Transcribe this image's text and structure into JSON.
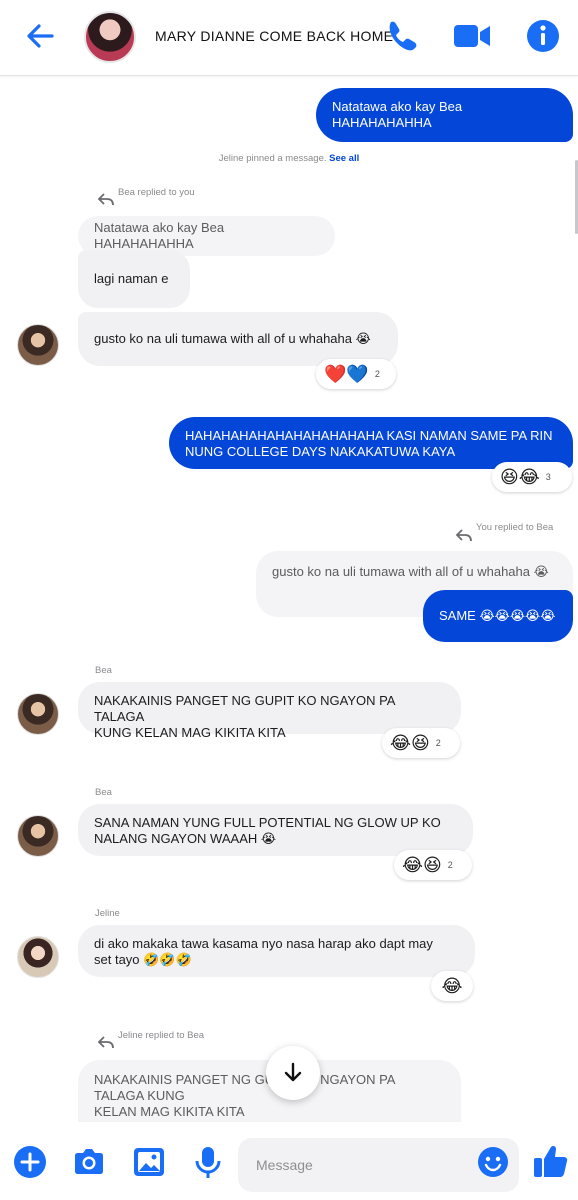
{
  "header": {
    "title": "MARY DIANNE COME BACK HOME",
    "back_icon": "back-arrow-icon",
    "call_icon": "phone-icon",
    "video_icon": "video-camera-icon",
    "info_icon": "info-icon"
  },
  "colors": {
    "accent": "#0346d8",
    "icon_blue": "#1a6ef5",
    "incoming_bubble": "#f1f1f4"
  },
  "messages": {
    "m1": {
      "text": "Natatawa ako kay Bea HAHAHAHAHHA"
    },
    "pin_notice": {
      "text": "Jeline pinned a message.",
      "link": "See all"
    },
    "m2": {
      "reply_label": "Bea replied to you",
      "quoted": "Natatawa ako kay Bea HAHAHAHAHHA",
      "text": "lagi naman e"
    },
    "m3": {
      "text": "gusto ko na uli tumawa with all of u whahaha 😭",
      "reactions": "❤️💙",
      "count": "2"
    },
    "m4": {
      "line1": "HAHAHAHAHAHAHAHAHAHAHA KASI NAMAN SAME PA RIN",
      "line2": "NUNG COLLEGE DAYS NAKAKATUWA KAYA",
      "reactions": "😆😂",
      "count": "3"
    },
    "m5": {
      "reply_label": "You replied to Bea",
      "quoted": "gusto ko na uli tumawa with all of u whahaha 😭",
      "text": "SAME 😭😭😭😭😭"
    },
    "m6": {
      "sender": "Bea",
      "line1": "NAKAKAINIS PANGET NG GUPIT KO NGAYON PA TALAGA",
      "line2": "KUNG KELAN MAG KIKITA KITA",
      "reactions": "😂😆",
      "count": "2"
    },
    "m7": {
      "sender": "Bea",
      "line1": "SANA NAMAN YUNG FULL POTENTIAL NG GLOW UP KO",
      "line2": "NALANG NGAYON WAAAH 😭",
      "reactions": "😂😆",
      "count": "2"
    },
    "m8": {
      "sender": "Jeline",
      "line1": "di ako makaka tawa kasama nyo nasa harap ako  dapt may",
      "line2": "set tayo 🤣🤣🤣",
      "reactions": "😂"
    },
    "m9": {
      "reply_label": "Jeline replied to Bea",
      "quoted_line1": "NAKAKAINIS PANGET NG GUPIT KO NGAYON PA TALAGA KUNG",
      "quoted_line2": "KELAN MAG KIKITA KITA"
    }
  },
  "composer": {
    "placeholder": "Message",
    "icons": [
      "plus-icon",
      "camera-icon",
      "image-icon",
      "microphone-icon",
      "emoji-icon",
      "thumbs-up-icon"
    ]
  }
}
